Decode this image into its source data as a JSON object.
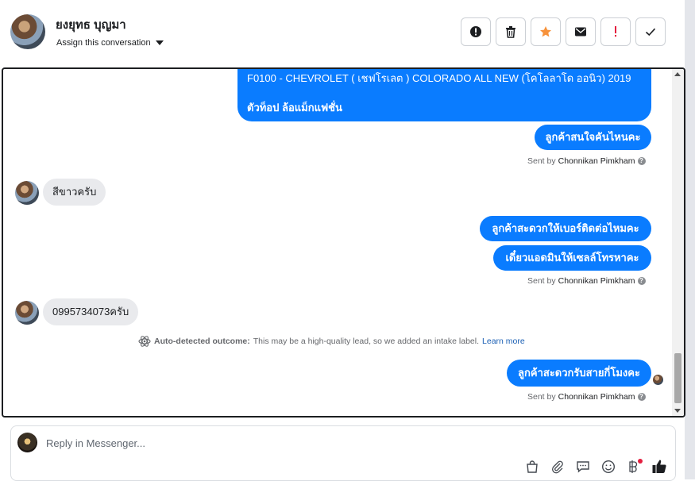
{
  "header": {
    "contact_name": "ยงยุทธ บุญมา",
    "assign_label": "Assign this conversation",
    "toolbar": [
      {
        "name": "spam-button",
        "icon": "alert-circle-icon"
      },
      {
        "name": "delete-button",
        "icon": "trash-icon"
      },
      {
        "name": "star-button",
        "icon": "star-icon",
        "color": "#f7923b"
      },
      {
        "name": "mark-unread-button",
        "icon": "envelope-icon"
      },
      {
        "name": "flag-important-button",
        "icon": "exclamation-icon",
        "color": "#e41e3f"
      },
      {
        "name": "mark-done-button",
        "icon": "checkmark-icon"
      }
    ]
  },
  "messages": {
    "m1_line1": "F0100 - CHEVROLET ( เชฟโรเลต ) COLORADO ALL NEW (โคโลลาโด ออนิว) 2019",
    "m1_line2": "ตัวท็อป ล้อแม็กแฟชั่น",
    "m2": "ลูกค้าสนใจคันไหนคะ",
    "m3": "สีขาวครับ",
    "m4": "ลูกค้าสะดวกให้เบอร์ติดต่อไหมคะ",
    "m5": "เดี๋ยวแอดมินให้เซลล์โทรหาคะ",
    "m6": "0995734073ครับ",
    "m7": "ลูกค้าสะดวกรับสายกี่โมงคะ"
  },
  "sent_by": {
    "prefix": "Sent by",
    "name": "Chonnikan Pimkham"
  },
  "outcome": {
    "label": "Auto-detected outcome:",
    "text": "This may be a high-quality lead, so we added an intake label.",
    "link": "Learn more"
  },
  "reply": {
    "placeholder": "Reply in Messenger..."
  },
  "colors": {
    "outgoing_bubble": "#0a7cff",
    "incoming_bubble": "#e9eaed"
  }
}
